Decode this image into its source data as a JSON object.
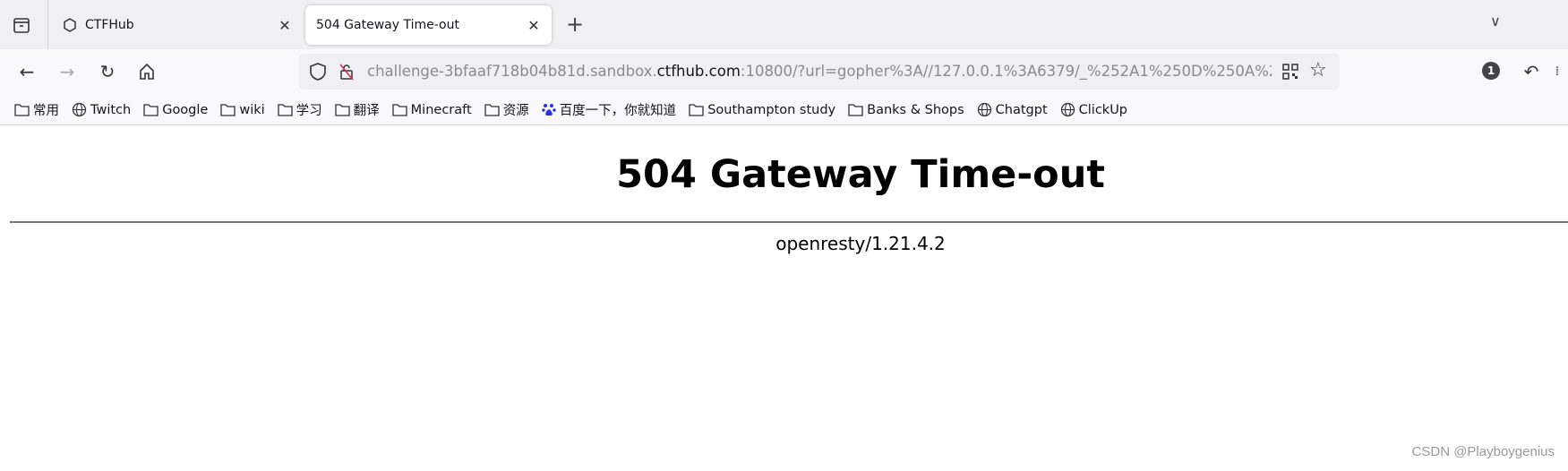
{
  "tabs": [
    {
      "label": "CTFHub",
      "active": false
    },
    {
      "label": "504 Gateway Time-out",
      "active": true
    }
  ],
  "url": {
    "prefix": "challenge-3bfaaf718b04b81d.sandbox.",
    "domain": "ctfhub.com",
    "suffix": ":10800/?url=gopher%3A//127.0.0.1%3A6379/_%252A1%250D%250A%2"
  },
  "bookmarks": [
    {
      "label": "常用",
      "icon": "folder-icon"
    },
    {
      "label": "Twitch",
      "icon": "globe-icon"
    },
    {
      "label": "Google",
      "icon": "folder-icon"
    },
    {
      "label": "wiki",
      "icon": "folder-icon"
    },
    {
      "label": "学习",
      "icon": "folder-icon"
    },
    {
      "label": "翻译",
      "icon": "folder-icon"
    },
    {
      "label": "Minecraft",
      "icon": "folder-icon"
    },
    {
      "label": "资源",
      "icon": "folder-icon"
    },
    {
      "label": "百度一下，你就知道",
      "icon": "baidu-icon"
    },
    {
      "label": "Southampton study",
      "icon": "folder-icon"
    },
    {
      "label": "Banks & Shops",
      "icon": "folder-icon"
    },
    {
      "label": "Chatgpt",
      "icon": "globe-icon"
    },
    {
      "label": "ClickUp",
      "icon": "globe-icon"
    }
  ],
  "page": {
    "heading": "504 Gateway Time-out",
    "server": "openresty/1.21.4.2"
  },
  "extension_badge": "1",
  "watermark": "CSDN @Playboygenius"
}
